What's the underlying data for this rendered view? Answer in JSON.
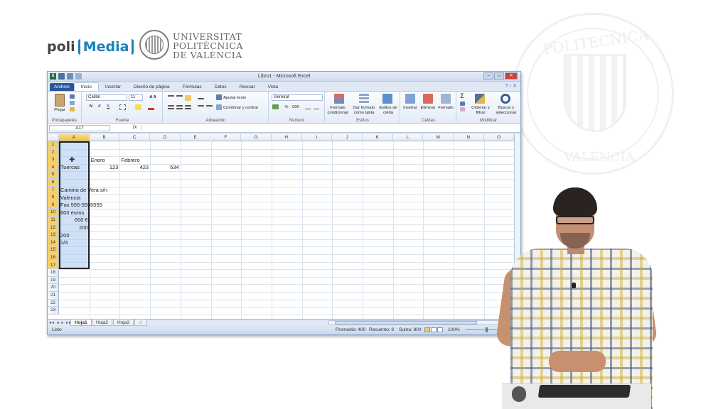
{
  "branding": {
    "poli_text": "poli",
    "media_text": "Media",
    "university_line1": "UNIVERSITAT",
    "university_line2": "POLITÈCNICA",
    "university_line3": "DE VALÈNCIA"
  },
  "watermark": {
    "top_text": "POLITECNICA",
    "bottom_text": "VALÈNCIA"
  },
  "window": {
    "title": "Libro1 - Microsoft Excel"
  },
  "tabs": [
    "Archivo",
    "Inicio",
    "Insertar",
    "Diseño de página",
    "Fórmulas",
    "Datos",
    "Revisar",
    "Vista"
  ],
  "ribbon": {
    "clipboard": {
      "paste": "Pegar",
      "label": "Portapapeles"
    },
    "font": {
      "name": "Calibri",
      "size": "11",
      "label": "Fuente",
      "bold": "N",
      "italic": "K",
      "underline": "S"
    },
    "alignment": {
      "wrap": "Ajustar texto",
      "merge": "Combinar y centrar",
      "label": "Alineación"
    },
    "number": {
      "format": "General",
      "percent": "%",
      "thousands": "000",
      "label": "Número"
    },
    "styles": {
      "conditional": "Formato condicional",
      "as_table": "Dar formato como tabla",
      "cell_styles": "Estilos de celda",
      "label": "Estilos"
    },
    "cells": {
      "insert": "Insertar",
      "delete": "Eliminar",
      "format": "Formato",
      "label": "Celdas"
    },
    "editing": {
      "sigma": "Σ",
      "sort": "Ordenar y filtrar",
      "find": "Buscar y seleccionar",
      "label": "Modificar"
    }
  },
  "formula_bar": {
    "name_box": "A17",
    "fx": "fx",
    "content": ""
  },
  "columns": [
    "A",
    "B",
    "C",
    "D",
    "E",
    "F",
    "G",
    "H",
    "I",
    "J",
    "K",
    "L",
    "M",
    "N",
    "O"
  ],
  "rows": [
    "1",
    "2",
    "3",
    "4",
    "5",
    "6",
    "7",
    "8",
    "9",
    "10",
    "11",
    "12",
    "13",
    "14",
    "15",
    "16",
    "17",
    "18",
    "19",
    "20",
    "21",
    "22",
    "23"
  ],
  "cells": {
    "B3": "Enero",
    "C3": "Febrero",
    "A4": "Tuercas",
    "B4": "123",
    "C4": "423",
    "D4": "534",
    "A7": "Camino de Vera s/n",
    "A8": "Valencia",
    "A9": "Fax 555-5555555",
    "A10": "600 euros",
    "A11": "600 €",
    "A12": "200",
    "A13": "200",
    "A14": "1/4"
  },
  "sheet_tabs": [
    "Hoja1",
    "Hoja2",
    "Hoja3"
  ],
  "status": {
    "mode": "Listo",
    "average": "Promedio: 400",
    "count": "Recuento: 9",
    "sum": "Suma: 800",
    "zoom": "100%"
  }
}
